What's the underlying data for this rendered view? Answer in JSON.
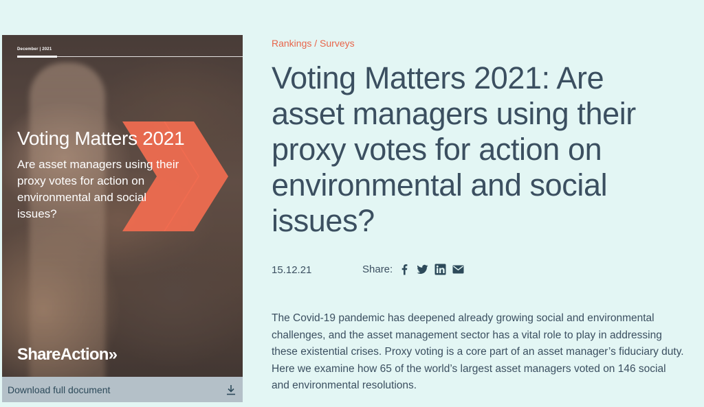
{
  "cover": {
    "date": "December | 2021",
    "title": "Voting Matters 2021",
    "subtitle": "Are asset managers using their proxy votes for action on environmental and social issues?",
    "logo": "ShareAction»",
    "download_label": "Download full document",
    "download_icon": "download-icon",
    "accent_color": "#f26d50"
  },
  "breadcrumb": {
    "item1": "Rankings",
    "separator": " / ",
    "item2": "Surveys"
  },
  "article": {
    "title": "Voting Matters 2021: Are asset managers using their proxy votes for action on environmental and social issues?",
    "date": "15.12.21",
    "body": "The Covid-19 pandemic has deepened already growing social and environmental challenges, and the asset management sector has a vital role to play in addressing these existential crises. Proxy voting is a core part of an asset manager’s fiduciary duty. Here we examine how 65 of the world’s largest asset managers voted on 146 social and environmental resolutions."
  },
  "share": {
    "label": "Share:",
    "icons": [
      "facebook-icon",
      "twitter-icon",
      "linkedin-icon",
      "email-icon"
    ]
  },
  "colors": {
    "background": "#e3f6f4",
    "text": "#3b4f60",
    "breadcrumb": "#e8654a",
    "download_bar": "#b4c0c8"
  }
}
